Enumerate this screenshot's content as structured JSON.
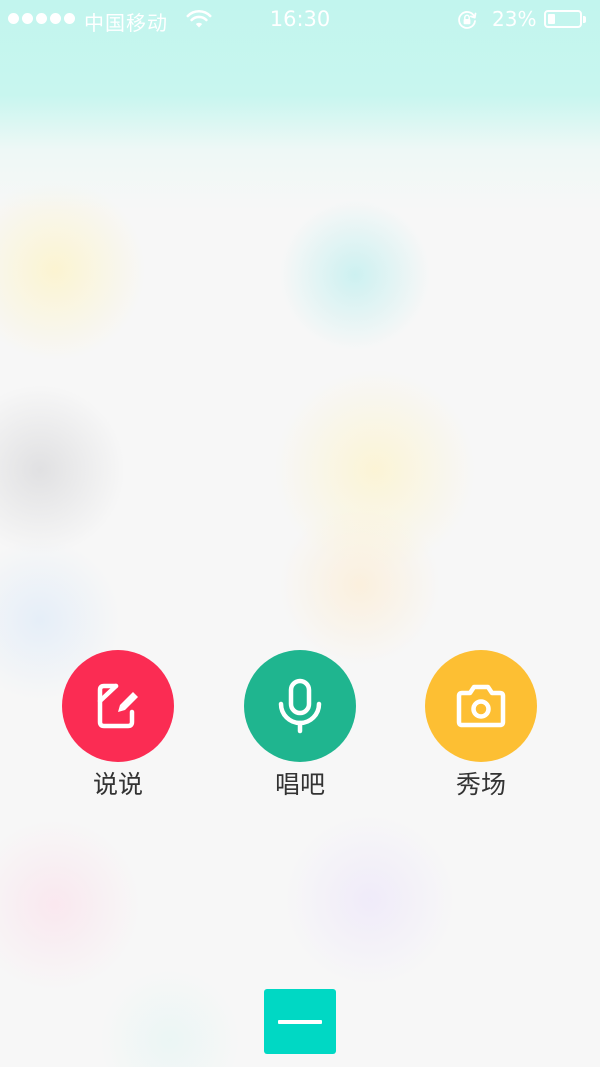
{
  "status_bar": {
    "carrier": "中国移动",
    "time": "16:30",
    "battery_percent_text": "23%",
    "battery_level": 0.23,
    "signal_icon": "signal-dots-icon",
    "wifi_icon": "wifi-icon",
    "lock_icon": "rotation-lock-icon"
  },
  "actions": [
    {
      "label": "说说",
      "icon": "edit-note-icon",
      "color": "#fb2c53"
    },
    {
      "label": "唱吧",
      "icon": "microphone-icon",
      "color": "#1fb58f"
    },
    {
      "label": "秀场",
      "icon": "camera-icon",
      "color": "#fdbf33"
    }
  ],
  "close_button": {
    "icon": "minus-icon",
    "color": "#00d8c4"
  }
}
